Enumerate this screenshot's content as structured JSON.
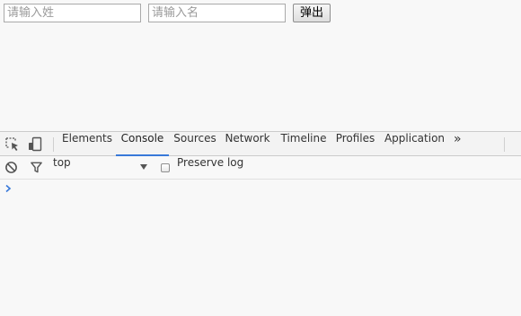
{
  "page": {
    "lastname_placeholder": "请输入姓",
    "firstname_placeholder": "请输入名",
    "popup_button_label": "弹出"
  },
  "devtools": {
    "tabs": [
      "Elements",
      "Console",
      "Sources",
      "Network",
      "Timeline",
      "Profiles",
      "Application"
    ],
    "active_tab": "Console",
    "more_tabs_label": "»",
    "context_label": "top",
    "preserve_log_label": "Preserve log",
    "preserve_log_checked": false,
    "accent_color": "#3879d9",
    "icons": [
      "inspect-element-icon",
      "device-toolbar-icon",
      "clear-console-icon",
      "filter-icon",
      "dropdown-arrow-icon",
      "console-prompt-icon"
    ]
  }
}
